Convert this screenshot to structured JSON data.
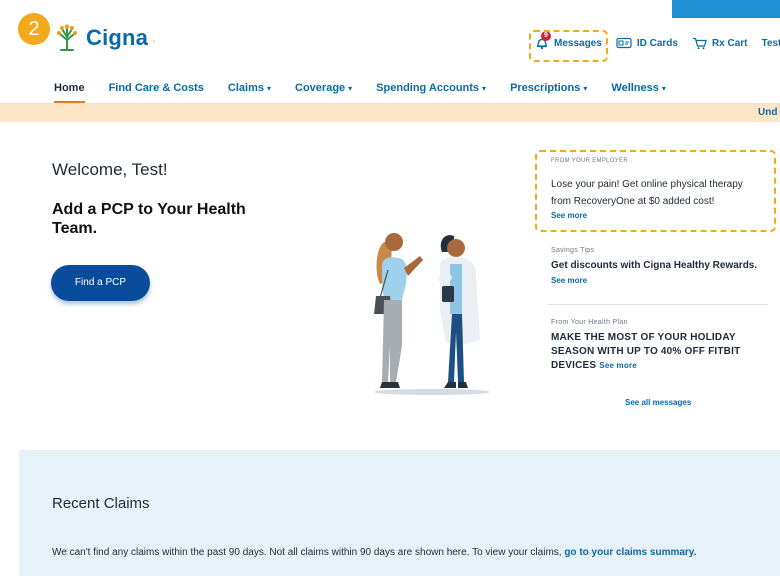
{
  "step_badge": "2",
  "brand": {
    "name": "Cigna",
    "mark": "."
  },
  "utility_nav": {
    "messages": {
      "label": "Messages",
      "count": "9"
    },
    "id_cards": "ID Cards",
    "rx_cart": "Rx Cart",
    "user": "Test"
  },
  "main_nav": [
    {
      "label": "Home",
      "dropdown": false
    },
    {
      "label": "Find Care & Costs",
      "dropdown": false
    },
    {
      "label": "Claims",
      "dropdown": true
    },
    {
      "label": "Coverage",
      "dropdown": true
    },
    {
      "label": "Spending Accounts",
      "dropdown": true
    },
    {
      "label": "Prescriptions",
      "dropdown": true
    },
    {
      "label": "Wellness",
      "dropdown": true
    }
  ],
  "banner_text": "Und",
  "hero": {
    "welcome": "Welcome, Test!",
    "heading": "Add a PCP to Your Health Team.",
    "button": "Find a PCP"
  },
  "messages": [
    {
      "eyebrow": "FROM YOUR EMPLOYER",
      "body_line1": "Lose your pain! Get online physical therapy",
      "body_line2": "from RecoveryOne at $0 added cost!",
      "link": "See more"
    },
    {
      "eyebrow": "Savings Tips",
      "body": "Get discounts with Cigna Healthy Rewards.",
      "link": "See more"
    },
    {
      "eyebrow": "From Your Health Plan",
      "body": "MAKE THE MOST OF YOUR HOLIDAY SEASON WITH UP TO 40% OFF FITBIT DEVICES",
      "link": "See more"
    }
  ],
  "see_all_messages": "See all messages",
  "claims": {
    "title": "Recent Claims",
    "text": "We can't find any claims within the past 90 days. Not all claims within 90 days are shown here. To view your claims,",
    "link": "go to your claims summary."
  },
  "colors": {
    "brand_blue": "#0a6aa5",
    "highlight": "#f3a91c",
    "nav_active": "#e07a28",
    "button": "#0a4c9c"
  }
}
